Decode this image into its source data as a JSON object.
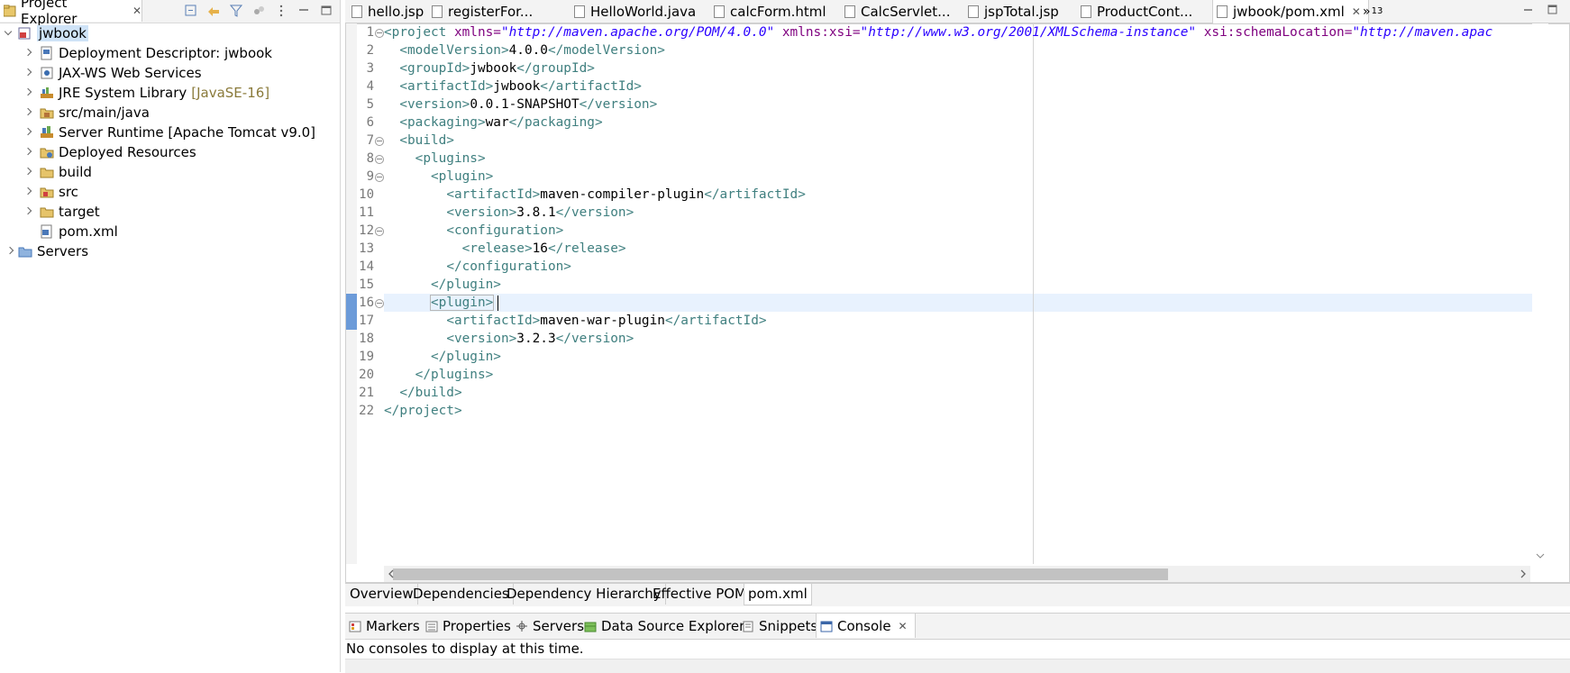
{
  "explorer": {
    "title": "Project Explorer",
    "close": "✕",
    "items": [
      {
        "label": "jwbook",
        "decoration": ""
      },
      {
        "label": "Deployment Descriptor: jwbook",
        "decoration": ""
      },
      {
        "label": "JAX-WS Web Services",
        "decoration": ""
      },
      {
        "label": "JRE System Library",
        "decoration": "[JavaSE-16]"
      },
      {
        "label": "src/main/java",
        "decoration": ""
      },
      {
        "label": "Server Runtime [Apache Tomcat v9.0]",
        "decoration": ""
      },
      {
        "label": "Deployed Resources",
        "decoration": ""
      },
      {
        "label": "build",
        "decoration": ""
      },
      {
        "label": "src",
        "decoration": ""
      },
      {
        "label": "target",
        "decoration": ""
      },
      {
        "label": "pom.xml",
        "decoration": ""
      },
      {
        "label": "Servers",
        "decoration": ""
      }
    ]
  },
  "editor_tabs": [
    {
      "label": "hello.jsp"
    },
    {
      "label": "registerFor..."
    },
    {
      "label": "HelloWorld.java"
    },
    {
      "label": "calcForm.html"
    },
    {
      "label": "CalcServlet..."
    },
    {
      "label": "jspTotal.jsp"
    },
    {
      "label": "ProductCont..."
    },
    {
      "label": "jwbook/pom.xml",
      "close": "✕"
    }
  ],
  "overflow": {
    "chevron": "»",
    "count": "13"
  },
  "line_numbers": [
    "1",
    "2",
    "3",
    "4",
    "5",
    "6",
    "7",
    "8",
    "9",
    "10",
    "11",
    "12",
    "13",
    "14",
    "15",
    "16",
    "17",
    "18",
    "19",
    "20",
    "21",
    "22"
  ],
  "code": {
    "l1": {
      "open": "<project",
      "a1": " xmlns=",
      "v1": "\"http://maven.apache.org/POM/4.0.0\"",
      "a2": " xmlns:xsi=",
      "v2": "\"http://www.w3.org/2001/XMLSchema-instance\"",
      "a3": " xsi:schemaLocation=",
      "v3": "\"http://maven.apac"
    },
    "l2": {
      "indent": "  ",
      "o": "<modelVersion>",
      "t": "4.0.0",
      "c": "</modelVersion>"
    },
    "l3": {
      "indent": "  ",
      "o": "<groupId>",
      "t": "jwbook",
      "c": "</groupId>"
    },
    "l4": {
      "indent": "  ",
      "o": "<artifactId>",
      "t": "jwbook",
      "c": "</artifactId>"
    },
    "l5": {
      "indent": "  ",
      "o": "<version>",
      "t": "0.0.1-SNAPSHOT",
      "c": "</version>"
    },
    "l6": {
      "indent": "  ",
      "o": "<packaging>",
      "t": "war",
      "c": "</packaging>"
    },
    "l7": {
      "indent": "  ",
      "o": "<build>"
    },
    "l8": {
      "indent": "    ",
      "o": "<plugins>"
    },
    "l9": {
      "indent": "      ",
      "o": "<plugin>"
    },
    "l10": {
      "indent": "        ",
      "o": "<artifactId>",
      "t": "maven-compiler-plugin",
      "c": "</artifactId>"
    },
    "l11": {
      "indent": "        ",
      "o": "<version>",
      "t": "3.8.1",
      "c": "</version>"
    },
    "l12": {
      "indent": "        ",
      "o": "<configuration>"
    },
    "l13": {
      "indent": "          ",
      "o": "<release>",
      "t": "16",
      "c": "</release>"
    },
    "l14": {
      "indent": "        ",
      "c": "</configuration>"
    },
    "l15": {
      "indent": "      ",
      "c": "</plugin>"
    },
    "l16": {
      "indent": "      ",
      "o": "<plugin>"
    },
    "l17": {
      "indent": "        ",
      "o": "<artifactId>",
      "t": "maven-war-plugin",
      "c": "</artifactId>"
    },
    "l18": {
      "indent": "        ",
      "o": "<version>",
      "t": "3.2.3",
      "c": "</version>"
    },
    "l19": {
      "indent": "      ",
      "c": "</plugin>"
    },
    "l20": {
      "indent": "    ",
      "c": "</plugins>"
    },
    "l21": {
      "indent": "  ",
      "c": "</build>"
    },
    "l22": {
      "indent": "",
      "c": "</project>"
    }
  },
  "pom_tabs": [
    "Overview",
    "Dependencies",
    "Dependency Hierarchy",
    "Effective POM",
    "pom.xml"
  ],
  "bottom_tabs": [
    {
      "label": "Markers"
    },
    {
      "label": "Properties"
    },
    {
      "label": "Servers"
    },
    {
      "label": "Data Source Explorer"
    },
    {
      "label": "Snippets"
    },
    {
      "label": "Console",
      "close": "✕"
    }
  ],
  "console_message": "No consoles to display at this time.",
  "icons": [
    "collapse-all-icon",
    "link-editor-icon",
    "filter-icon",
    "focus-icon",
    "view-menu-icon",
    "minimize-icon",
    "maximize-icon",
    "markers-icon",
    "properties-icon",
    "servers-icon",
    "data-source-icon",
    "snippets-icon",
    "console-icon"
  ]
}
